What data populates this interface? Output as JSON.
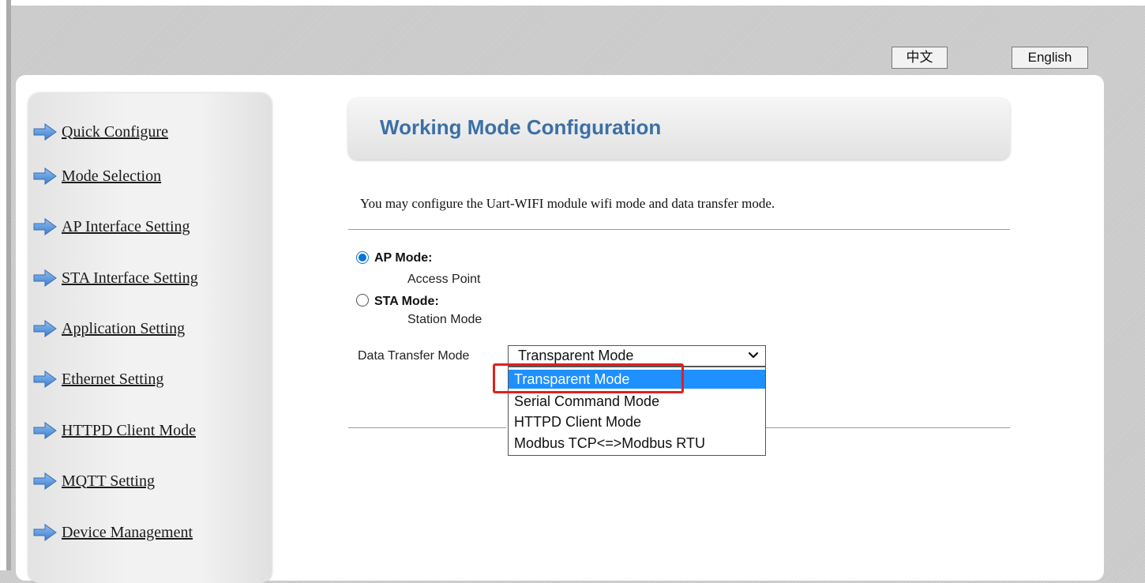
{
  "language": {
    "chinese_label": "中文",
    "english_label": "English"
  },
  "sidebar": {
    "items": [
      {
        "label": "Quick Configure"
      },
      {
        "label": "Mode Selection"
      },
      {
        "label": "AP Interface Setting"
      },
      {
        "label": "STA Interface Setting"
      },
      {
        "label": "Application Setting"
      },
      {
        "label": "Ethernet Setting"
      },
      {
        "label": "HTTPD Client Mode"
      },
      {
        "label": "MQTT Setting"
      },
      {
        "label": "Device Management"
      }
    ],
    "icon": "right-arrow-icon"
  },
  "main": {
    "title": "Working Mode Configuration",
    "description": "You may configure the Uart-WIFI module wifi mode and data transfer mode.",
    "ap_mode": {
      "label": "AP Mode:",
      "description": "Access Point",
      "checked": true
    },
    "sta_mode": {
      "label": "STA Mode:",
      "description": "Station Mode",
      "checked": false
    },
    "data_transfer": {
      "label": "Data Transfer Mode",
      "selected": "Transparent Mode",
      "options": [
        "Transparent Mode",
        "Serial Command Mode",
        "HTTPD Client Mode",
        "Modbus TCP<=>Modbus RTU"
      ]
    }
  },
  "colors": {
    "title": "#3c6fa6",
    "radio_accent": "#0a74da",
    "selected_option_bg": "#1e90ff",
    "highlight_border": "#e02020",
    "nav_arrow": "#5b93d8"
  }
}
